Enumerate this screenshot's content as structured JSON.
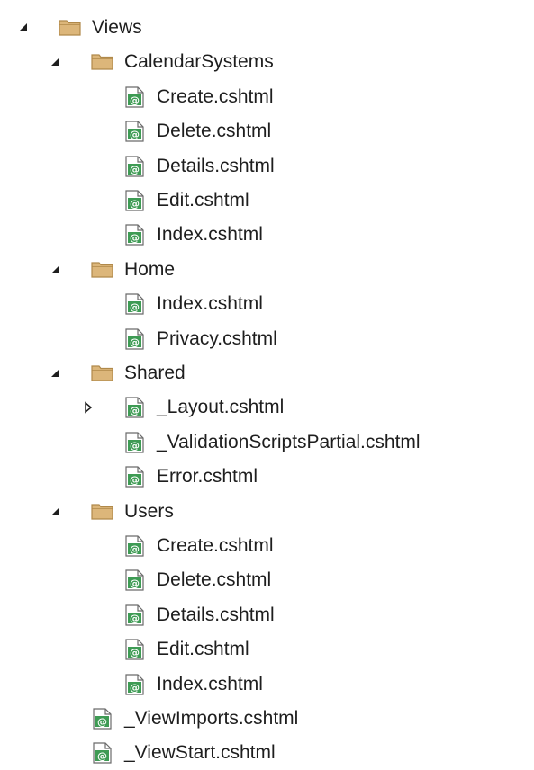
{
  "explorer": {
    "nodes": [
      {
        "label": "Views",
        "type": "folder",
        "level": 0,
        "expander": "expanded"
      },
      {
        "label": "CalendarSystems",
        "type": "folder",
        "level": 1,
        "expander": "expanded"
      },
      {
        "label": "Create.cshtml",
        "type": "file",
        "level": 2,
        "expander": "none"
      },
      {
        "label": "Delete.cshtml",
        "type": "file",
        "level": 2,
        "expander": "none"
      },
      {
        "label": "Details.cshtml",
        "type": "file",
        "level": 2,
        "expander": "none"
      },
      {
        "label": "Edit.cshtml",
        "type": "file",
        "level": 2,
        "expander": "none"
      },
      {
        "label": "Index.cshtml",
        "type": "file",
        "level": 2,
        "expander": "none"
      },
      {
        "label": "Home",
        "type": "folder",
        "level": 1,
        "expander": "expanded"
      },
      {
        "label": "Index.cshtml",
        "type": "file",
        "level": 2,
        "expander": "none"
      },
      {
        "label": "Privacy.cshtml",
        "type": "file",
        "level": 2,
        "expander": "none"
      },
      {
        "label": "Shared",
        "type": "folder",
        "level": 1,
        "expander": "expanded"
      },
      {
        "label": "_Layout.cshtml",
        "type": "file",
        "level": 2,
        "expander": "collapsed"
      },
      {
        "label": "_ValidationScriptsPartial.cshtml",
        "type": "file",
        "level": 2,
        "expander": "none"
      },
      {
        "label": "Error.cshtml",
        "type": "file",
        "level": 2,
        "expander": "none"
      },
      {
        "label": "Users",
        "type": "folder",
        "level": 1,
        "expander": "expanded"
      },
      {
        "label": "Create.cshtml",
        "type": "file",
        "level": 2,
        "expander": "none"
      },
      {
        "label": "Delete.cshtml",
        "type": "file",
        "level": 2,
        "expander": "none"
      },
      {
        "label": "Details.cshtml",
        "type": "file",
        "level": 2,
        "expander": "none"
      },
      {
        "label": "Edit.cshtml",
        "type": "file",
        "level": 2,
        "expander": "none"
      },
      {
        "label": "Index.cshtml",
        "type": "file",
        "level": 2,
        "expander": "none"
      },
      {
        "label": "_ViewImports.cshtml",
        "type": "file",
        "level": 1,
        "expander": "none"
      },
      {
        "label": "_ViewStart.cshtml",
        "type": "file",
        "level": 1,
        "expander": "none"
      }
    ],
    "icons": {
      "folder": "folder-icon",
      "file": "razor-file-icon",
      "expanded": "expanded-arrow-icon",
      "collapsed": "collapsed-arrow-icon",
      "file_glyph": "@"
    },
    "colors": {
      "folder_fill": "#DCB67A",
      "folder_stroke": "#B0894A",
      "razor_green": "#3E9B54",
      "text": "#1E1E1E",
      "arrow": "#1E1E1E"
    }
  }
}
